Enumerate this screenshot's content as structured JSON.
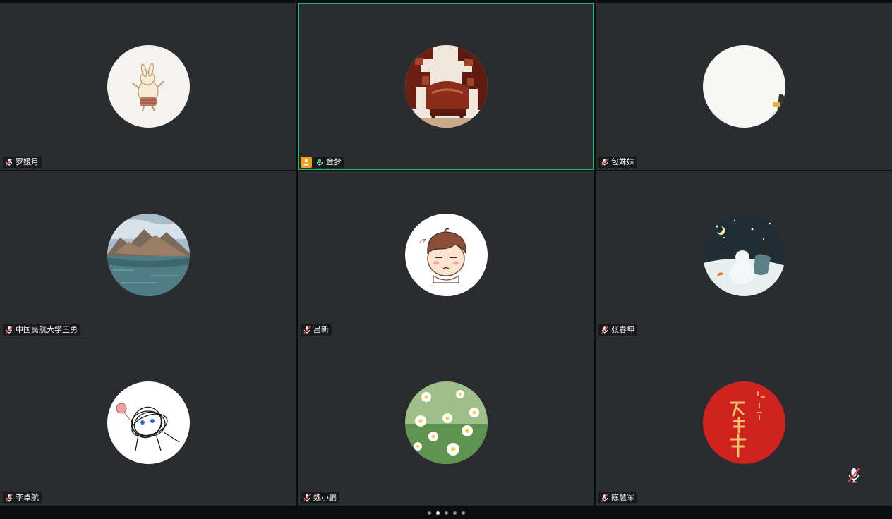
{
  "participants": [
    {
      "name": "罗媛月",
      "avatar_icon": "rabbit-avatar-icon",
      "muted": true,
      "host": false,
      "active": false
    },
    {
      "name": "金梦",
      "avatar_icon": "carved-chair-avatar-icon",
      "muted": false,
      "host": true,
      "active": true
    },
    {
      "name": "包姝妹",
      "avatar_icon": "white-avatar-icon",
      "muted": true,
      "host": false,
      "active": false
    },
    {
      "name": "中国民航大学王勇",
      "avatar_icon": "mountain-lake-avatar-icon",
      "muted": true,
      "host": false,
      "active": false
    },
    {
      "name": "吕新",
      "avatar_icon": "cartoon-boy-avatar-icon",
      "muted": true,
      "host": false,
      "active": false
    },
    {
      "name": "张春坤",
      "avatar_icon": "snowman-avatar-icon",
      "muted": true,
      "host": false,
      "active": false
    },
    {
      "name": "李卓航",
      "avatar_icon": "scribble-avatar-icon",
      "muted": true,
      "host": false,
      "active": false
    },
    {
      "name": "魏小鹏",
      "avatar_icon": "daisies-avatar-icon",
      "muted": true,
      "host": false,
      "active": false
    },
    {
      "name": "陈慧军",
      "avatar_icon": "red-calligraphy-avatar-icon",
      "muted": true,
      "host": false,
      "active": false
    }
  ],
  "pager": {
    "total": 5,
    "current": 2
  },
  "colors": {
    "tile_bg": "#2b2c30",
    "active_border": "#1fbf6c",
    "host_badge": "#f0a020",
    "mute_red": "#e5484d",
    "mic_on_green": "#2fbf71"
  },
  "self_mic": {
    "icon": "muted-microphone-icon",
    "muted": true
  }
}
